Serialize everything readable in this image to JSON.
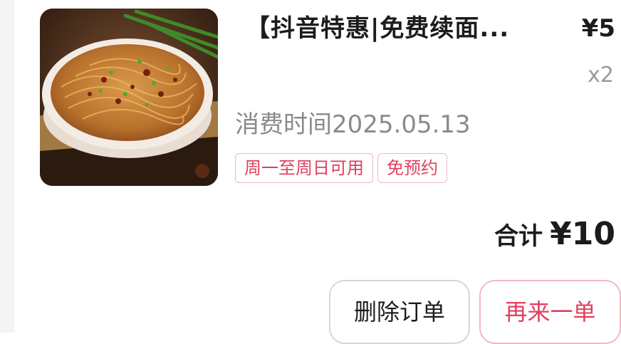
{
  "order": {
    "title": "【抖音特惠|免费续面...",
    "unit_price": "¥5",
    "quantity": "x2",
    "consume_time": "消费时间2025.05.13",
    "tags": [
      "周一至周日可用",
      "免预约"
    ],
    "total_label": "合计",
    "total_amount": "¥10",
    "image_icon": "noodle-dish-photo"
  },
  "actions": {
    "delete_label": "删除订单",
    "reorder_label": "再来一单"
  },
  "colors": {
    "accent": "#e0405f",
    "tag_border": "#e9b9c4",
    "muted_text": "#8a8a8a"
  }
}
